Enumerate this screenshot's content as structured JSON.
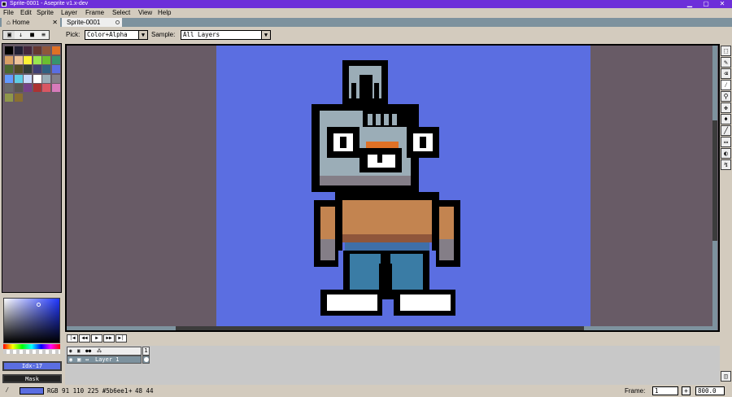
{
  "window": {
    "title": "Sprite-0001 - Aseprite v1.x-dev",
    "minimize": "▁",
    "maximize": "▢",
    "close": "✕"
  },
  "menu": [
    "File",
    "Edit",
    "Sprite",
    "Layer",
    "Frame",
    "Select",
    "View",
    "Help"
  ],
  "tabs": {
    "home": "Home",
    "home_close": "✕",
    "sprite": "Sprite-0001"
  },
  "toolbar": {
    "pick_label": "Pick:",
    "pick_value": "Color+Alpha",
    "sample_label": "Sample:",
    "sample_value": "All Layers"
  },
  "palette": {
    "colors": [
      "#000000",
      "#222034",
      "#45283c",
      "#663931",
      "#8f563b",
      "#df7126",
      "#d9a066",
      "#eec39a",
      "#fbf236",
      "#99e550",
      "#6abe30",
      "#37946e",
      "#4b692f",
      "#524b24",
      "#323c39",
      "#3f3f74",
      "#306082",
      "#5b6ee1",
      "#639bff",
      "#5fcde4",
      "#cbdbfc",
      "#ffffff",
      "#9badb7",
      "#847e87",
      "#696a6a",
      "#595652",
      "#76428a",
      "#ac3232",
      "#d95763",
      "#d77bba",
      "#8f974a",
      "#8a6f30"
    ]
  },
  "color_panel": {
    "index_label": "Idx-17",
    "mask_label": "Mask"
  },
  "timeline": {
    "layer_name": "Layer 1",
    "frame_number": "1"
  },
  "status": {
    "color_info": "RGB 91 110 225 #5b6ee1",
    "coords": "48 44",
    "frame_label": "Frame:",
    "frame_value": "1",
    "zoom": "800.0"
  },
  "colors": {
    "accent": "#6d2fd9",
    "canvas": "#5b6ee1",
    "editor_bg": "#685b66",
    "panel": "#d3cbbe"
  }
}
